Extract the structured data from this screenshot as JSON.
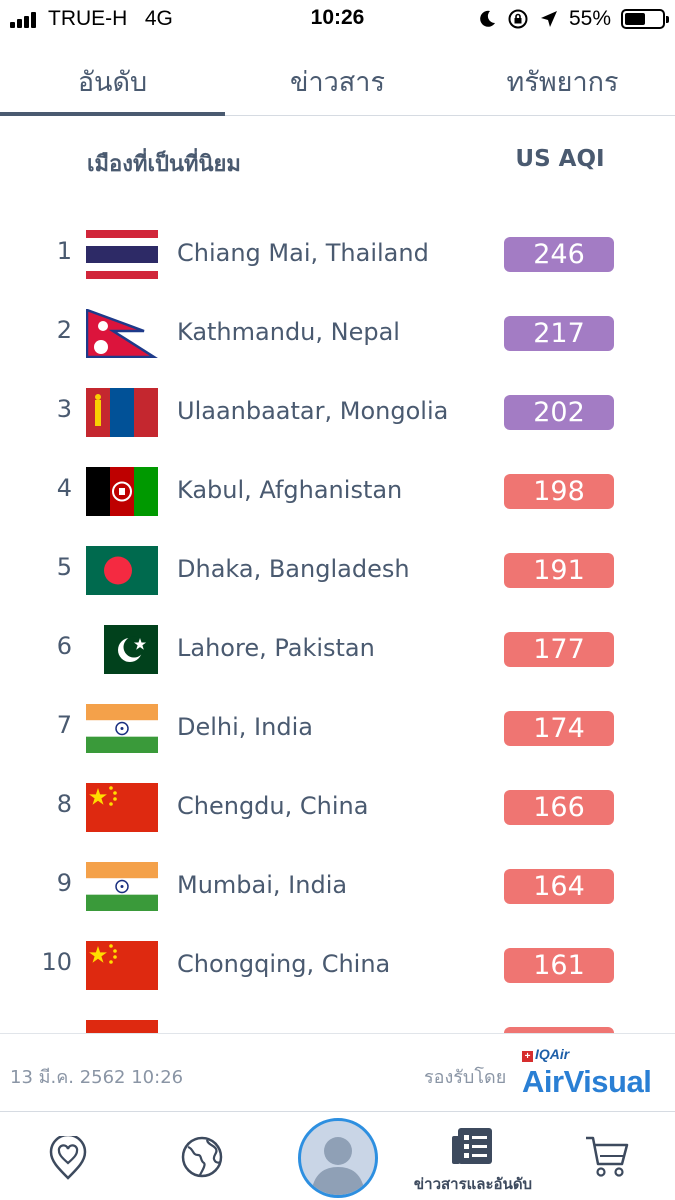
{
  "status_bar": {
    "carrier": "TRUE-H",
    "network": "4G",
    "time": "10:26",
    "battery": "55%",
    "battery_level": 0.55
  },
  "tabs": [
    {
      "label": "อันดับ",
      "active": true
    },
    {
      "label": "ข่าวสาร",
      "active": false
    },
    {
      "label": "ทรัพยากร",
      "active": false
    }
  ],
  "list_header": {
    "city": "เมืองที่เป็นที่นิยม",
    "aqi": "US AQI"
  },
  "colors": {
    "very_unhealthy": "#a37cc4",
    "unhealthy": "#ef7572"
  },
  "rows": [
    {
      "rank": "1",
      "city": "Chiang Mai, Thailand",
      "aqi": "246",
      "level": "very_unhealthy",
      "flag": "thailand-flag-icon"
    },
    {
      "rank": "2",
      "city": "Kathmandu, Nepal",
      "aqi": "217",
      "level": "very_unhealthy",
      "flag": "nepal-flag-icon"
    },
    {
      "rank": "3",
      "city": "Ulaanbaatar, Mongolia",
      "aqi": "202",
      "level": "very_unhealthy",
      "flag": "mongolia-flag-icon"
    },
    {
      "rank": "4",
      "city": "Kabul, Afghanistan",
      "aqi": "198",
      "level": "unhealthy",
      "flag": "afghanistan-flag-icon"
    },
    {
      "rank": "5",
      "city": "Dhaka, Bangladesh",
      "aqi": "191",
      "level": "unhealthy",
      "flag": "bangladesh-flag-icon"
    },
    {
      "rank": "6",
      "city": "Lahore, Pakistan",
      "aqi": "177",
      "level": "unhealthy",
      "flag": "pakistan-flag-icon"
    },
    {
      "rank": "7",
      "city": "Delhi, India",
      "aqi": "174",
      "level": "unhealthy",
      "flag": "india-flag-icon"
    },
    {
      "rank": "8",
      "city": "Chengdu, China",
      "aqi": "166",
      "level": "unhealthy",
      "flag": "china-flag-icon"
    },
    {
      "rank": "9",
      "city": "Mumbai, India",
      "aqi": "164",
      "level": "unhealthy",
      "flag": "india-flag-icon"
    },
    {
      "rank": "10",
      "city": "Chongqing, China",
      "aqi": "161",
      "level": "unhealthy",
      "flag": "china-flag-icon"
    }
  ],
  "footer": {
    "timestamp": "13 มี.ค. 2562 10:26",
    "sponsor_label": "รองรับโดย",
    "sponsor_small": "IQAir",
    "sponsor_brand": "AirVisual"
  },
  "bottom_nav": {
    "items": [
      {
        "icon": "heart-location-icon"
      },
      {
        "icon": "globe-icon"
      },
      {
        "icon": "profile-avatar-icon"
      },
      {
        "icon": "news-ranking-icon",
        "label": "ข่าวสารและอันดับ",
        "active": true
      },
      {
        "icon": "shopping-cart-icon"
      }
    ]
  }
}
